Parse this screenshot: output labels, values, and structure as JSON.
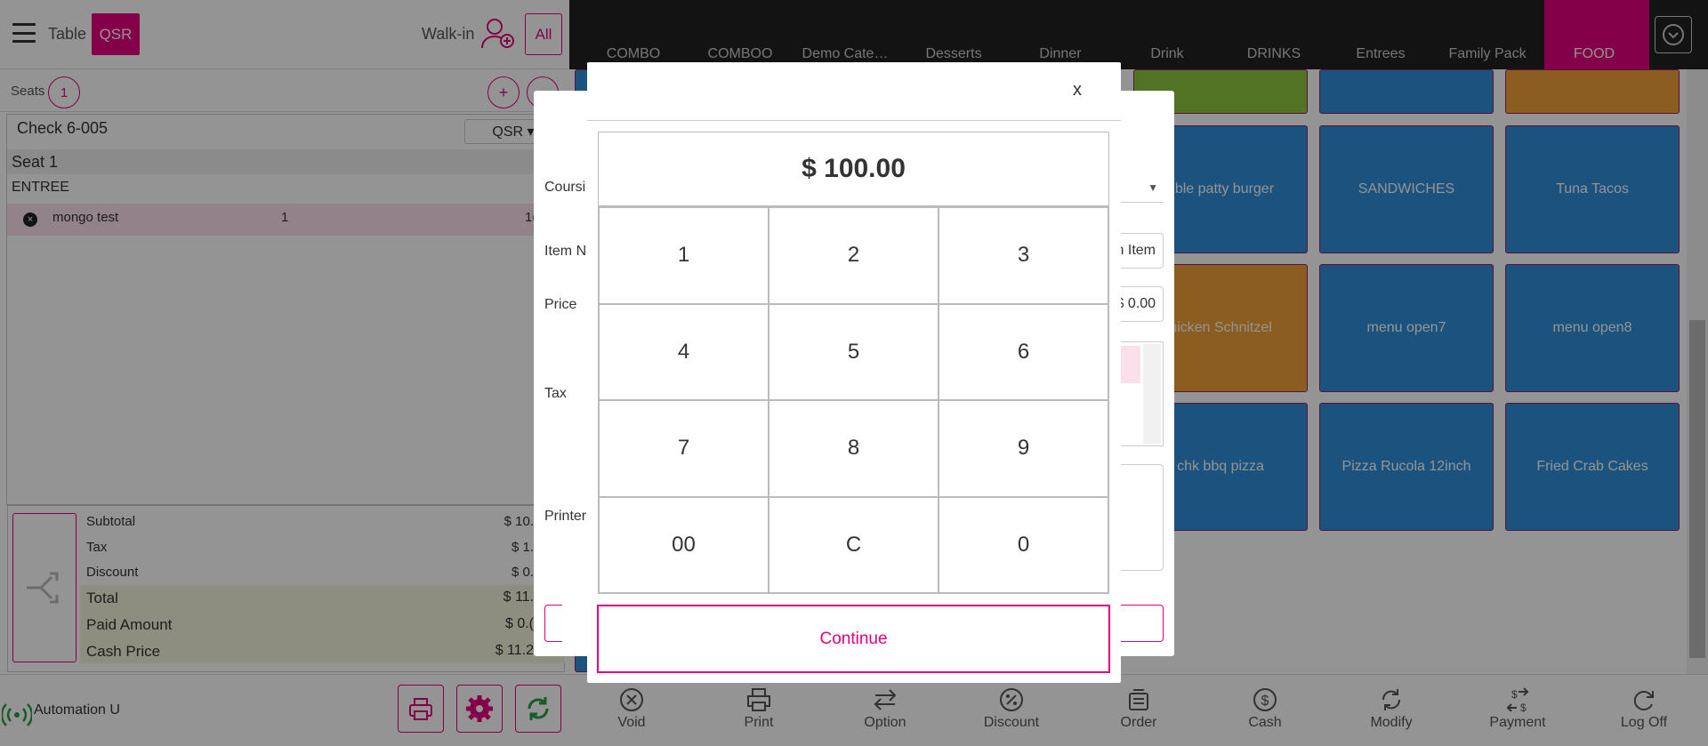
{
  "header": {
    "table_label": "Table",
    "qsr_label": "QSR",
    "walkin_label": "Walk-in",
    "all_label": "All"
  },
  "seats": {
    "label": "Seats",
    "count": "1",
    "add_label": "+",
    "collapse_label": "⌄"
  },
  "check": {
    "title": "Check 6-005",
    "mode": "QSR ▾",
    "seat_label": "Seat 1",
    "course": "ENTREE",
    "items": [
      {
        "name": "mongo test",
        "qty": "1",
        "price": "1("
      }
    ]
  },
  "totals": {
    "subtotal_label": "Subtotal",
    "subtotal": "$ 10.",
    "tax_label": "Tax",
    "tax": "$ 1.",
    "discount_label": "Discount",
    "discount": "$ 0.",
    "total_label": "Total",
    "total": "$ 11.",
    "paid_label": "Paid Amount",
    "paid": "$ 0.(",
    "cash_label": "Cash Price",
    "cash": "$ 11.2"
  },
  "footer_left": {
    "user": "Automation U"
  },
  "categories": [
    "COMBO",
    "COMBOO",
    "Demo Cate…",
    "Desserts",
    "Dinner",
    "Drink",
    "DRINKS",
    "Entrees",
    "Family Pack",
    "FOOD"
  ],
  "menu_tiles": [
    "uble patty burger",
    "SANDWICHES",
    "Tuna Tacos",
    "hicken Schnitzel",
    "menu open7",
    "menu open8",
    "chk bbq pizza",
    "Pizza Rucola 12inch",
    "Fried Crab Cakes"
  ],
  "actions": [
    "Void",
    "Print",
    "Option",
    "Discount",
    "Order",
    "Cash",
    "Modify",
    "Payment",
    "Log Off"
  ],
  "back_dialog": {
    "coursing_label": "Coursi",
    "item_name_label": "Item Na",
    "price_label": "Price",
    "tax_label": "Tax",
    "printer_label": "Printer",
    "item_button": "n Item",
    "price_value": "$ 0.00"
  },
  "numpad": {
    "close": "x",
    "display": "$ 100.00",
    "keys": [
      "1",
      "2",
      "3",
      "4",
      "5",
      "6",
      "7",
      "8",
      "9",
      "00",
      "C",
      "0"
    ],
    "continue_label": "Continue"
  },
  "colors": {
    "accent": "#e4007c",
    "tile_blue": "#2f8fd9",
    "tile_orange": "#f0a13a",
    "tile_green": "#8dc63f"
  }
}
